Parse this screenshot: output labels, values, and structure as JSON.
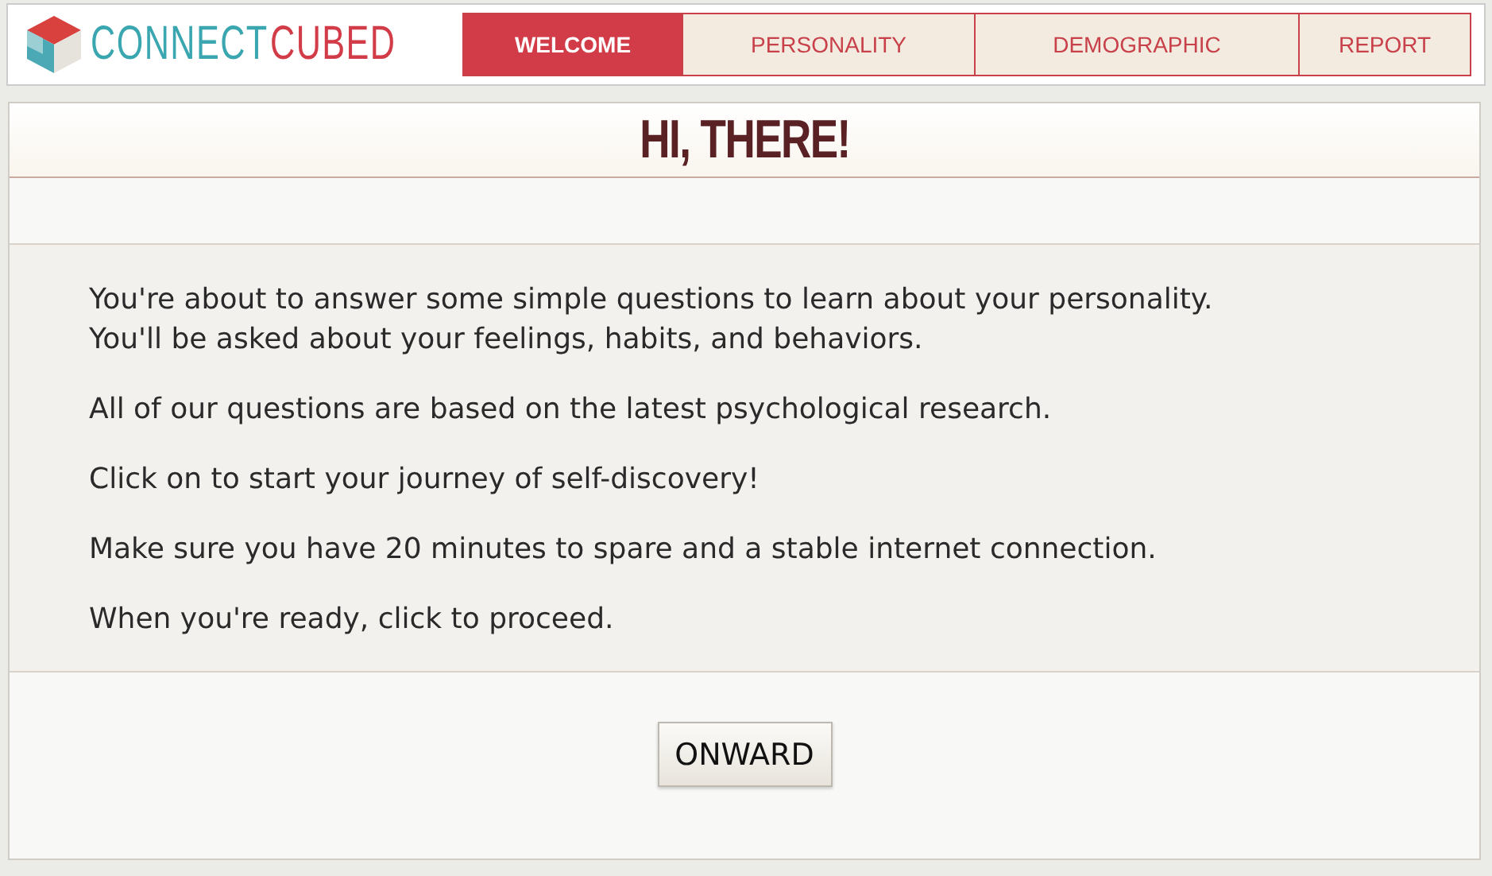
{
  "logo": {
    "words": [
      {
        "text": "CONNECT",
        "color": "#3aa6b0"
      },
      {
        "text": "CUBED",
        "color": "#d23c48"
      }
    ]
  },
  "tabs": [
    {
      "label": "WELCOME",
      "selected": true
    },
    {
      "label": "PERSONALITY",
      "selected": false
    },
    {
      "label": "DEMOGRAPHIC",
      "selected": false
    },
    {
      "label": "REPORT",
      "selected": false
    }
  ],
  "heading": "HI, THERE!",
  "paragraphs": [
    "You're about to answer some simple questions to learn about your personality.\nYou'll be asked about your feelings, habits, and behaviors.",
    "All of our questions are based on the latest psychological research.",
    "Click on to start your journey of self-discovery!",
    "Make sure you have 20 minutes to spare and a stable internet connection.",
    "When you're ready, click to proceed."
  ],
  "button": "ONWARD"
}
